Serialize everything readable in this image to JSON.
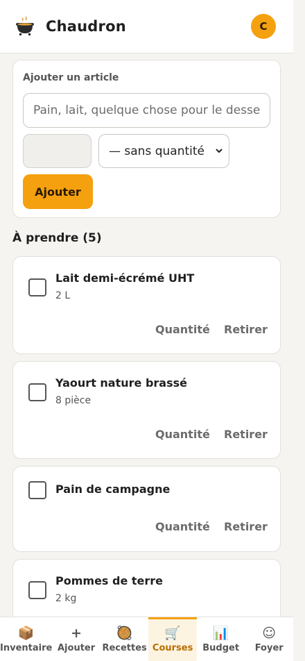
{
  "header": {
    "title": "Chaudron",
    "avatar_initial": "C"
  },
  "add_form": {
    "label": "Ajouter un article",
    "item_placeholder": "Pain, lait, quelque chose pour le dessert…",
    "quantity_value": "",
    "unit_selected": "— sans quantité",
    "submit_label": "Ajouter"
  },
  "list": {
    "section_title": "À prendre (5)",
    "quantity_action": "Quantité",
    "remove_action": "Retirer",
    "items": [
      {
        "name": "Lait demi-écrémé UHT",
        "qty": "2 L"
      },
      {
        "name": "Yaourt nature brassé",
        "qty": "8 pièce"
      },
      {
        "name": "Pain de campagne",
        "qty": ""
      },
      {
        "name": "Pommes de terre",
        "qty": "2 kg"
      }
    ]
  },
  "nav": {
    "items": [
      {
        "label": "Inventaire",
        "icon": "box-icon",
        "glyph": "📦"
      },
      {
        "label": "Ajouter",
        "icon": "plus-icon",
        "glyph": "+"
      },
      {
        "label": "Recettes",
        "icon": "pot-icon",
        "glyph": "🥘"
      },
      {
        "label": "Courses",
        "icon": "cart-icon",
        "glyph": "🛒",
        "active": true
      },
      {
        "label": "Budget",
        "icon": "chart-icon",
        "glyph": "📊"
      },
      {
        "label": "Foyer",
        "icon": "smiley-icon",
        "glyph": "☺"
      }
    ]
  },
  "colors": {
    "accent": "#f4a00f",
    "background": "#f5f4f1"
  }
}
